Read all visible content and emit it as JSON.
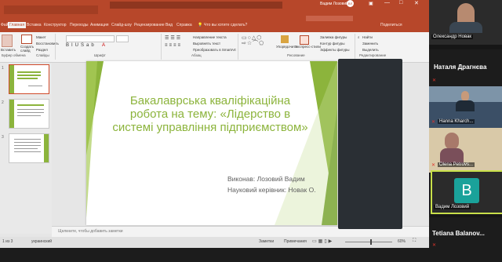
{
  "titlebar": {
    "search_hint": "Что вы хотите сделать?",
    "user_name": "Вадим Лозовий",
    "avatar_initials": "ВЛ",
    "share_label": "Поделиться"
  },
  "ribbon_tabs": [
    "Файл",
    "Главная",
    "Вставка",
    "Конструктор",
    "Переходы",
    "Анимация",
    "Слайд-шоу",
    "Рецензирование",
    "Вид",
    "Справка"
  ],
  "ribbon": {
    "paste": "Вставить",
    "create_slide": "Создать слайд",
    "layout": "Макет",
    "reset": "Восстановить",
    "section": "Раздел",
    "group_clipboard": "Буфер обмена",
    "group_slides": "Слайды",
    "group_font": "Шрифт",
    "group_paragraph": "Абзац",
    "group_drawing": "Рисование",
    "group_editing": "Редактирование",
    "text_direction": "Направление текста",
    "align_text": "Выровнять текст",
    "convert_smartart": "Преобразовать в SmartArt",
    "arrange": "Упорядочить",
    "quick_styles": "Экспресс-стили",
    "shape_fill": "Заливка фигуры",
    "shape_outline": "Контур фигуры",
    "shape_effects": "Эффекты фигуры",
    "find": "Найти",
    "replace": "Заменить",
    "select": "Выделить"
  },
  "slide": {
    "title": "Бакалаврська кваліфікаційна робота на тему: «Лідерство в системі управління підприємством»",
    "author": "Виконав: Лозовий Вадим",
    "advisor": "Науковий керівник: Новак О."
  },
  "thumbnails": [
    "1",
    "2",
    "3"
  ],
  "notes_placeholder": "Щелкните, чтобы добавить заметки",
  "status": {
    "slide_info": "1 из 3",
    "language": "украинский",
    "notes": "Заметки",
    "comments": "Примечания",
    "zoom": "60%"
  },
  "participants": [
    {
      "name": "Олександр Новак",
      "muted": false
    },
    {
      "name": "Наталя Драгнєва",
      "muted": true
    },
    {
      "name": "Hanna Kharch...",
      "muted": true
    },
    {
      "name": "Olena Petrovs...",
      "muted": true
    },
    {
      "name": "Вадим Лозовий",
      "initial": "В",
      "muted": false
    },
    {
      "name": "Tetiana Balanov...",
      "muted": true
    }
  ]
}
